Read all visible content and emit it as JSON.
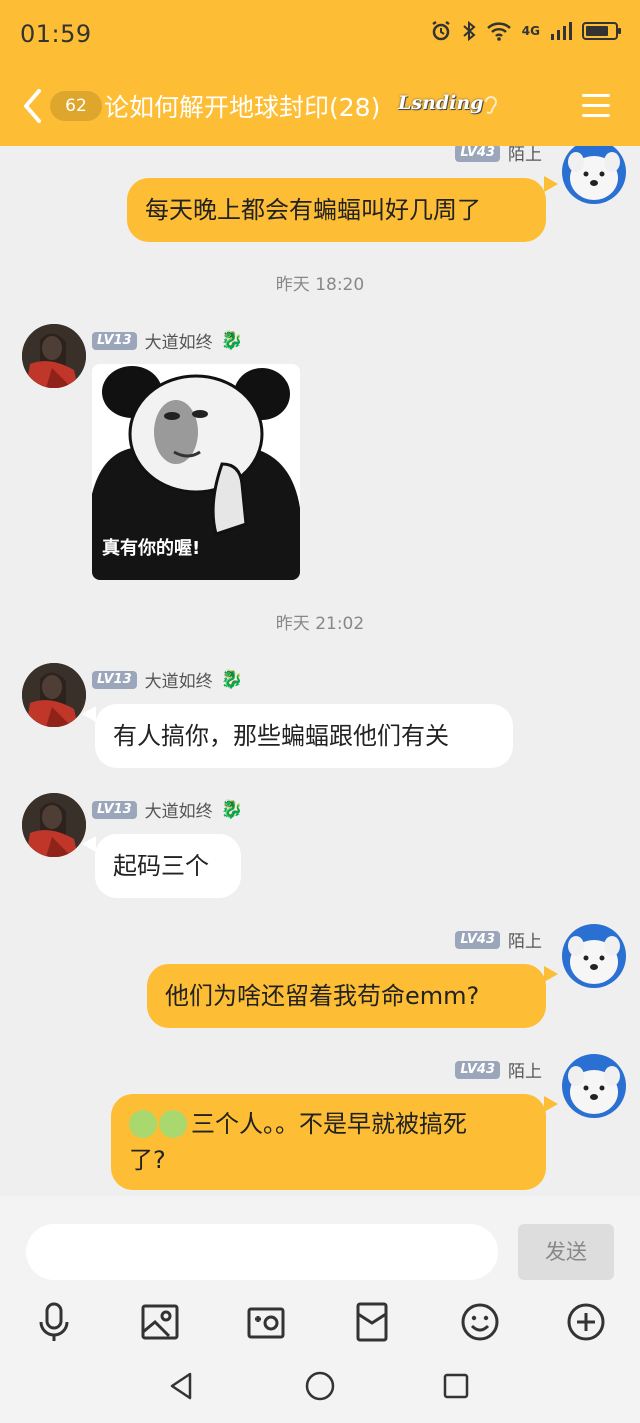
{
  "status_bar": {
    "time": "01:59",
    "network": "4G"
  },
  "header": {
    "unread_count": "62",
    "title": "论如何解开地球封印(28)",
    "title_decoration": "Lsnding"
  },
  "messages": [
    {
      "sender": "陌上",
      "level": "LV43",
      "text": "每天晚上都会有蝙蝠叫好几周了"
    },
    {
      "timestamp": "昨天 18:20"
    },
    {
      "sender": "大道如终",
      "level": "LV13",
      "sticker_caption": "真有你的喔!"
    },
    {
      "timestamp": "昨天 21:02"
    },
    {
      "sender": "大道如终",
      "level": "LV13",
      "text": "有人搞你，那些蝙蝠跟他们有关"
    },
    {
      "sender": "大道如终",
      "level": "LV13",
      "text": "起码三个"
    },
    {
      "sender": "陌上",
      "level": "LV43",
      "text": "他们为啥还留着我苟命emm?"
    },
    {
      "sender": "陌上",
      "level": "LV43",
      "text_line1": "三个人。。不是早就被搞死",
      "text_line2": "了?"
    }
  ],
  "input": {
    "placeholder": "",
    "send_label": "发送"
  },
  "toolbar": [
    "mic-icon",
    "image-icon",
    "camera-icon",
    "red-packet-icon",
    "emoji-icon",
    "plus-icon"
  ],
  "colors": {
    "accent": "#fdbd34",
    "background": "#efefef"
  }
}
